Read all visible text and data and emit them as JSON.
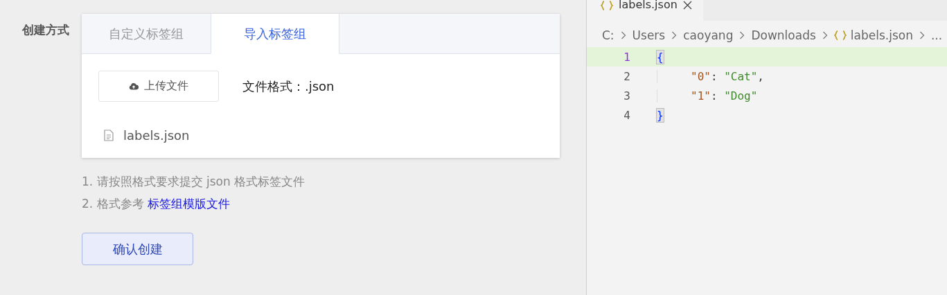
{
  "form": {
    "label": "创建方式",
    "tabs": [
      {
        "label": "自定义标签组",
        "selected": false
      },
      {
        "label": "导入标签组",
        "selected": true
      }
    ],
    "upload_button": "上传文件",
    "format_note": "文件格式：.json",
    "files": [
      {
        "name": "labels.json"
      }
    ],
    "hints": [
      {
        "text": "1. 请按照格式要求提交 json 格式标签文件"
      },
      {
        "text": "2. 格式参考 ",
        "link": "标签组模版文件"
      }
    ],
    "submit_button": "确认创建"
  },
  "editor": {
    "tab": {
      "title": "labels.json"
    },
    "breadcrumb": [
      {
        "kind": "folder",
        "text": "C:"
      },
      {
        "kind": "folder",
        "text": "Users"
      },
      {
        "kind": "folder",
        "text": "caoyang"
      },
      {
        "kind": "folder",
        "text": "Downloads"
      },
      {
        "kind": "file",
        "text": "labels.json"
      },
      {
        "kind": "more",
        "text": "..."
      }
    ],
    "lines": [
      {
        "number": "1",
        "current": true,
        "indented": false,
        "tokens": [
          {
            "kind": "bracket",
            "text": "{"
          }
        ]
      },
      {
        "number": "2",
        "current": false,
        "indented": true,
        "tokens": [
          {
            "kind": "key",
            "text": "\"0\""
          },
          {
            "kind": "punct",
            "text": ": "
          },
          {
            "kind": "string",
            "text": "\"Cat\""
          },
          {
            "kind": "punct",
            "text": ","
          }
        ]
      },
      {
        "number": "3",
        "current": false,
        "indented": true,
        "tokens": [
          {
            "kind": "key",
            "text": "\"1\""
          },
          {
            "kind": "punct",
            "text": ": "
          },
          {
            "kind": "string",
            "text": "\"Dog\""
          }
        ]
      },
      {
        "number": "4",
        "current": false,
        "indented": false,
        "tokens": [
          {
            "kind": "bracket",
            "text": "}"
          }
        ]
      }
    ]
  }
}
